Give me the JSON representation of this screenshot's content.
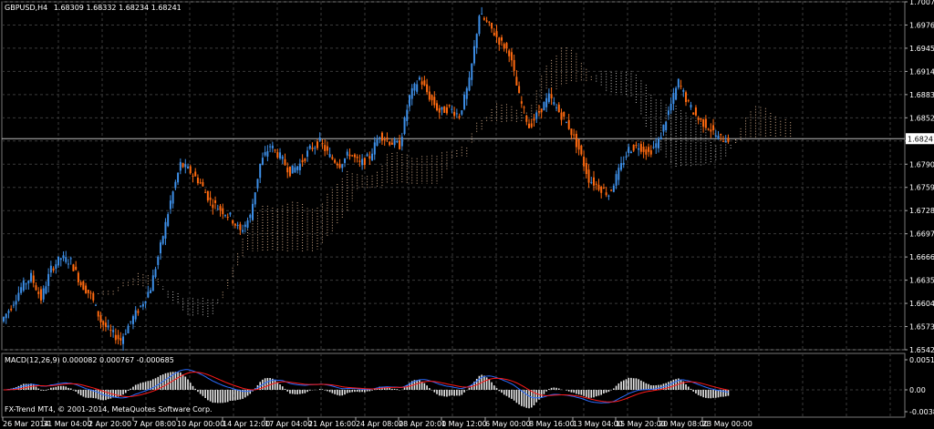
{
  "header": {
    "symbol": "GBPUSD,H4",
    "ohlc": "1.68309 1.68332 1.68234 1.68241"
  },
  "macd": {
    "label": "MACD(12,26,9) 0.000082 0.000767 -0.000685",
    "y_labels": [
      "0.00517",
      "0.00",
      "-0.00385"
    ]
  },
  "copyright": "FX-Trend MT4, © 2001-2014, MetaQuotes Software Corp.",
  "current_price_label": "1.68241",
  "colors": {
    "background": "#000000",
    "grid": "#3a3a3a",
    "bull": "#3d8ee6",
    "bear": "#ff6a10",
    "cloud_bull": "#f4c7a0",
    "cloud_bear": "#d8d8d8",
    "macd_main": "#2a6cff",
    "macd_signal": "#ff1a1a",
    "macd_hist": "#e8e8e8"
  },
  "chart_data": {
    "type": "candlestick",
    "y_ticks": [
      "1.70070",
      "1.69760",
      "1.69450",
      "1.69140",
      "1.68830",
      "1.68520",
      "1.68210",
      "1.67900",
      "1.67590",
      "1.67280",
      "1.66970",
      "1.66660",
      "1.66350",
      "1.66040",
      "1.65730",
      "1.65420"
    ],
    "x_labels": [
      "26 Mar 2014",
      "31 Mar 04:00",
      "2 Apr 20:00",
      "7 Apr 08:00",
      "10 Apr 00:00",
      "14 Apr 12:00",
      "17 Apr 04:00",
      "21 Apr 16:00",
      "24 Apr 08:00",
      "28 Apr 20:00",
      "1 May 12:00",
      "6 May 00:00",
      "8 May 16:00",
      "13 May 04:00",
      "15 May 20:00",
      "20 May 08:00",
      "23 May 00:00"
    ],
    "ylim": [
      1.6542,
      1.7007
    ],
    "last_price": 1.68241,
    "price_path": [
      [
        0,
        1.658
      ],
      [
        4,
        1.66
      ],
      [
        8,
        1.6625
      ],
      [
        12,
        1.664
      ],
      [
        16,
        1.661
      ],
      [
        20,
        1.665
      ],
      [
        24,
        1.6665
      ],
      [
        28,
        1.666
      ],
      [
        32,
        1.663
      ],
      [
        36,
        1.6615
      ],
      [
        40,
        1.658
      ],
      [
        44,
        1.6565
      ],
      [
        48,
        1.6555
      ],
      [
        52,
        1.658
      ],
      [
        56,
        1.66
      ],
      [
        60,
        1.6625
      ],
      [
        64,
        1.668
      ],
      [
        68,
        1.674
      ],
      [
        72,
        1.679
      ],
      [
        76,
        1.678
      ],
      [
        80,
        1.6765
      ],
      [
        84,
        1.674
      ],
      [
        88,
        1.673
      ],
      [
        92,
        1.672
      ],
      [
        96,
        1.67
      ],
      [
        100,
        1.672
      ],
      [
        104,
        1.679
      ],
      [
        108,
        1.6815
      ],
      [
        112,
        1.68
      ],
      [
        116,
        1.678
      ],
      [
        120,
        1.679
      ],
      [
        124,
        1.681
      ],
      [
        128,
        1.682
      ],
      [
        132,
        1.68
      ],
      [
        136,
        1.679
      ],
      [
        140,
        1.6805
      ],
      [
        144,
        1.679
      ],
      [
        148,
        1.68
      ],
      [
        152,
        1.683
      ],
      [
        156,
        1.682
      ],
      [
        160,
        1.6815
      ],
      [
        164,
        1.688
      ],
      [
        168,
        1.6905
      ],
      [
        172,
        1.688
      ],
      [
        176,
        1.686
      ],
      [
        180,
        1.6865
      ],
      [
        184,
        1.6855
      ],
      [
        188,
        1.69
      ],
      [
        192,
        1.699
      ],
      [
        196,
        1.6975
      ],
      [
        200,
        1.6955
      ],
      [
        204,
        1.694
      ],
      [
        208,
        1.688
      ],
      [
        212,
        1.684
      ],
      [
        216,
        1.686
      ],
      [
        220,
        1.688
      ],
      [
        224,
        1.686
      ],
      [
        228,
        1.684
      ],
      [
        232,
        1.681
      ],
      [
        236,
        1.677
      ],
      [
        240,
        1.676
      ],
      [
        244,
        1.675
      ],
      [
        248,
        1.678
      ],
      [
        252,
        1.681
      ],
      [
        256,
        1.6815
      ],
      [
        260,
        1.6805
      ],
      [
        264,
        1.682
      ],
      [
        268,
        1.686
      ],
      [
        272,
        1.69
      ],
      [
        276,
        1.687
      ],
      [
        280,
        1.685
      ],
      [
        284,
        1.684
      ],
      [
        288,
        1.6825
      ],
      [
        292,
        1.6824
      ]
    ]
  }
}
